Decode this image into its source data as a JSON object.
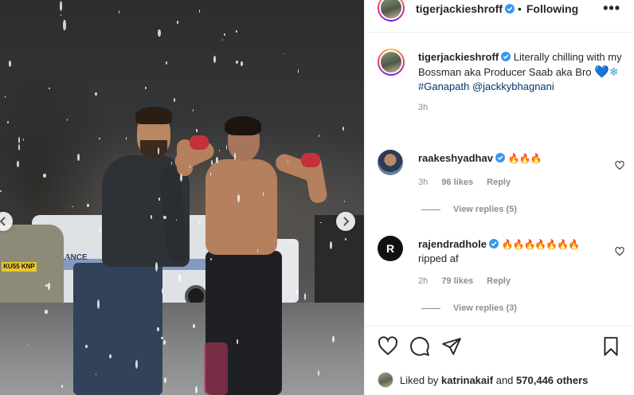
{
  "post": {
    "author": "tigerjackieshroff",
    "follow_status": "Following",
    "separator": "•",
    "more_label": "•••",
    "van_text": "ULANCE",
    "plate_text": "KU55 KNP"
  },
  "caption": {
    "username": "tigerjackieshroff",
    "text_line": "Literally chilling with my Bossman aka Producer Saab aka Bro",
    "emoji_heart": "💙",
    "emoji_snow": "❄",
    "hashtag": "#Ganapath",
    "mention": "@jackkybhagnani",
    "time": "3h"
  },
  "comments": [
    {
      "username": "raakeshyadhav",
      "text": "🔥🔥🔥",
      "time": "3h",
      "likes": "96 likes",
      "reply_label": "Reply",
      "view_replies": "View replies (5)"
    },
    {
      "username": "rajendradhole",
      "text": "🔥🔥🔥🔥🔥🔥🔥",
      "text2": "ripped af",
      "avatar_letter": "R",
      "time": "2h",
      "likes": "79 likes",
      "reply_label": "Reply",
      "view_replies": "View replies (3)"
    }
  ],
  "likes_line": {
    "prefix": "Liked by",
    "user": "katrinakaif",
    "connector": "and",
    "others": "570,446 others"
  },
  "colors": {
    "text": "#262626",
    "muted": "#8e8e8e",
    "link": "#00376b",
    "verified": "#3897f0"
  }
}
